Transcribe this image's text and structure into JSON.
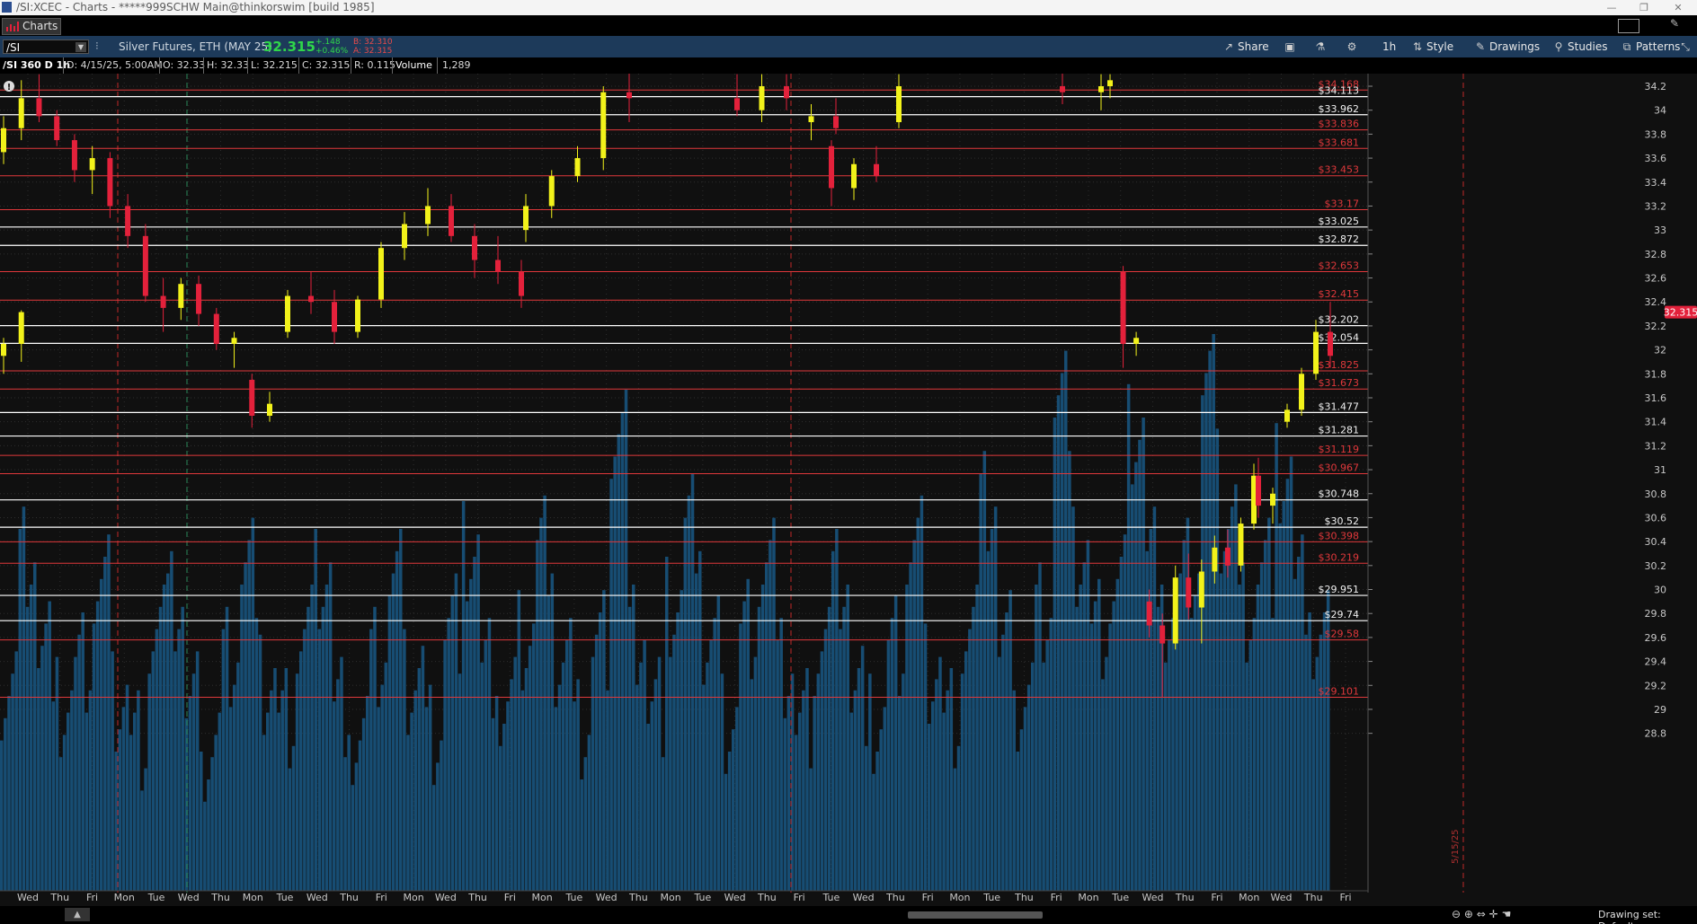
{
  "window": {
    "title": "/SI:XCEC - Charts - *****999SCHW Main@thinkorswim [build 1985]"
  },
  "tabs": {
    "charts_label": "Charts"
  },
  "toolbar": {
    "symbol": "/SI",
    "description": "Silver Futures, ETH (MAY 25)",
    "last": "32.315",
    "change": "+.148",
    "change_pct": "+0.46%",
    "bid": "B: 32.310",
    "ask": "A: 32.315",
    "share_label": "Share",
    "timeframe": "1h",
    "style_label": "Style",
    "drawings_label": "Drawings",
    "studies_label": "Studies",
    "patterns_label": "Patterns"
  },
  "infobar": {
    "chart_id": "/SI 360 D 1h",
    "date": "D: 4/15/25, 5:00AM",
    "open": "O: 32.33",
    "high": "H: 32.33",
    "low": "L: 32.215",
    "close": "C: 32.315",
    "range": "R: 0.115",
    "volume_label": "Volume",
    "volume_value": "1,289"
  },
  "colors": {
    "bg": "#101010",
    "grid": "#2e2e2e",
    "up_candle": "#f2f21a",
    "down_candle": "#e3213b",
    "volume": "#174d73",
    "white_level": "#ffffff",
    "red_level": "#e0383b",
    "price_bubble": "#e3213b"
  },
  "chart_data": {
    "type": "candlestick",
    "current_price": "32.315",
    "ylim": [
      28.7,
      34.35
    ],
    "y_ticks": [
      "34.2",
      "34",
      "33.8",
      "33.6",
      "33.4",
      "33.2",
      "33",
      "32.8",
      "32.6",
      "32.4",
      "32.2",
      "32",
      "31.8",
      "31.6",
      "31.4",
      "31.2",
      "31",
      "30.8",
      "30.6",
      "30.4",
      "30.2",
      "30",
      "29.8",
      "29.6",
      "29.4",
      "29.2",
      "29",
      "28.8"
    ],
    "x_labels": [
      "Wed",
      "Thu",
      "Fri",
      "Mon",
      "Tue",
      "Wed",
      "Thu",
      "Mon",
      "Tue",
      "Wed",
      "Thu",
      "Fri",
      "Mon",
      "Wed",
      "Thu",
      "Fri",
      "Mon",
      "Tue",
      "Wed",
      "Thu",
      "Mon",
      "Tue",
      "Wed",
      "Thu",
      "Fri",
      "Tue",
      "Wed",
      "Thu",
      "Fri",
      "Mon",
      "Tue",
      "Thu",
      "Fri",
      "Mon",
      "Tue",
      "Wed",
      "Thu",
      "Fri",
      "Mon",
      "Wed",
      "Thu",
      "Fri"
    ],
    "vertical_marker_label": "5/15/25",
    "levels": [
      {
        "value": 34.168,
        "label": "$34.168",
        "kind": "red"
      },
      {
        "value": 34.113,
        "label": "$34.113",
        "kind": "white"
      },
      {
        "value": 33.962,
        "label": "$33.962",
        "kind": "white"
      },
      {
        "value": 33.836,
        "label": "$33.836",
        "kind": "red"
      },
      {
        "value": 33.681,
        "label": "$33.681",
        "kind": "red"
      },
      {
        "value": 33.453,
        "label": "$33.453",
        "kind": "red"
      },
      {
        "value": 33.17,
        "label": "$33.17",
        "kind": "red"
      },
      {
        "value": 33.025,
        "label": "$33.025",
        "kind": "white"
      },
      {
        "value": 32.872,
        "label": "$32.872",
        "kind": "white"
      },
      {
        "value": 32.653,
        "label": "$32.653",
        "kind": "red"
      },
      {
        "value": 32.415,
        "label": "$32.415",
        "kind": "red"
      },
      {
        "value": 32.202,
        "label": "$32.202",
        "kind": "white"
      },
      {
        "value": 32.054,
        "label": "$32.054",
        "kind": "white"
      },
      {
        "value": 31.825,
        "label": "$31.825",
        "kind": "red"
      },
      {
        "value": 31.673,
        "label": "$31.673",
        "kind": "red"
      },
      {
        "value": 31.477,
        "label": "$31.477",
        "kind": "white"
      },
      {
        "value": 31.281,
        "label": "$31.281",
        "kind": "white"
      },
      {
        "value": 31.119,
        "label": "$31.119",
        "kind": "red"
      },
      {
        "value": 30.967,
        "label": "$30.967",
        "kind": "red"
      },
      {
        "value": 30.748,
        "label": "$30.748",
        "kind": "white"
      },
      {
        "value": 30.52,
        "label": "$30.52",
        "kind": "white"
      },
      {
        "value": 30.398,
        "label": "$30.398",
        "kind": "red"
      },
      {
        "value": 30.219,
        "label": "$30.219",
        "kind": "red"
      },
      {
        "value": 29.951,
        "label": "$29.951",
        "kind": "white"
      },
      {
        "value": 29.74,
        "label": "$29.74",
        "kind": "white"
      },
      {
        "value": 29.58,
        "label": "$29.58",
        "kind": "red"
      },
      {
        "value": 29.101,
        "label": "$29.101",
        "kind": "red"
      }
    ],
    "candles": [
      [
        33.65,
        33.95,
        33.55,
        33.85
      ],
      [
        33.85,
        34.25,
        33.75,
        34.1
      ],
      [
        34.1,
        34.3,
        33.9,
        33.95
      ],
      [
        33.95,
        34.0,
        33.7,
        33.75
      ],
      [
        33.75,
        33.8,
        33.4,
        33.5
      ],
      [
        33.5,
        33.7,
        33.3,
        33.6
      ],
      [
        33.6,
        33.65,
        33.1,
        33.2
      ],
      [
        33.2,
        33.3,
        32.85,
        32.95
      ],
      [
        32.95,
        33.05,
        32.4,
        32.45
      ],
      [
        32.45,
        32.6,
        32.15,
        32.35
      ],
      [
        32.35,
        32.6,
        32.25,
        32.55
      ],
      [
        32.55,
        32.62,
        32.2,
        32.3
      ],
      [
        32.3,
        32.35,
        32.0,
        32.05
      ],
      [
        32.05,
        32.15,
        31.85,
        32.1
      ],
      [
        31.75,
        31.8,
        31.35,
        31.45
      ],
      [
        31.45,
        31.65,
        31.4,
        31.55
      ],
      [
        32.15,
        32.5,
        32.1,
        32.45
      ],
      [
        32.45,
        32.65,
        32.3,
        32.4
      ],
      [
        32.4,
        32.5,
        32.05,
        32.15
      ],
      [
        32.15,
        32.45,
        32.1,
        32.42
      ],
      [
        32.42,
        32.9,
        32.35,
        32.85
      ],
      [
        32.85,
        33.15,
        32.75,
        33.05
      ],
      [
        33.05,
        33.35,
        32.95,
        33.2
      ],
      [
        33.2,
        33.3,
        32.9,
        32.95
      ],
      [
        32.95,
        33.05,
        32.6,
        32.75
      ],
      [
        32.75,
        32.95,
        32.55,
        32.65
      ],
      [
        32.65,
        32.75,
        32.35,
        32.45
      ],
      [
        33.0,
        33.3,
        32.9,
        33.2
      ],
      [
        33.2,
        33.5,
        33.1,
        33.45
      ],
      [
        33.45,
        33.7,
        33.4,
        33.6
      ],
      [
        33.6,
        34.2,
        33.5,
        34.15
      ],
      [
        34.15,
        34.35,
        33.9,
        34.1
      ],
      [
        34.1,
        34.3,
        33.95,
        34.0
      ],
      [
        34.0,
        34.3,
        33.9,
        34.2
      ],
      [
        34.2,
        34.3,
        34.0,
        34.1
      ],
      [
        33.9,
        34.05,
        33.75,
        33.95
      ],
      [
        33.95,
        34.1,
        33.8,
        33.85
      ],
      [
        33.7,
        33.75,
        33.2,
        33.35
      ],
      [
        33.35,
        33.6,
        33.25,
        33.55
      ],
      [
        33.55,
        33.7,
        33.4,
        33.45
      ],
      [
        33.9,
        34.3,
        33.85,
        34.2
      ],
      [
        34.2,
        34.35,
        34.05,
        34.15
      ],
      [
        34.15,
        34.3,
        34.0,
        34.2
      ],
      [
        34.2,
        34.3,
        34.1,
        34.25
      ],
      [
        32.65,
        32.7,
        31.85,
        32.05
      ],
      [
        32.05,
        32.15,
        31.95,
        32.1
      ],
      [
        29.9,
        30.0,
        29.6,
        29.7
      ],
      [
        29.7,
        29.8,
        29.1,
        29.55
      ],
      [
        29.55,
        30.2,
        29.5,
        30.1
      ],
      [
        30.1,
        30.3,
        29.75,
        29.85
      ],
      [
        29.85,
        30.25,
        29.55,
        30.15
      ],
      [
        30.15,
        30.45,
        30.05,
        30.35
      ],
      [
        30.35,
        30.5,
        30.1,
        30.2
      ],
      [
        30.2,
        30.6,
        30.15,
        30.55
      ],
      [
        30.55,
        31.05,
        30.5,
        30.95
      ],
      [
        30.95,
        31.1,
        30.6,
        30.7
      ],
      [
        30.7,
        30.85,
        30.55,
        30.8
      ],
      [
        31.4,
        31.55,
        31.35,
        31.5
      ],
      [
        31.5,
        31.85,
        31.45,
        31.8
      ],
      [
        31.8,
        32.25,
        31.75,
        32.15
      ],
      [
        32.15,
        32.4,
        31.85,
        31.95
      ],
      [
        31.95,
        32.1,
        31.8,
        32.05
      ],
      [
        32.05,
        32.33,
        31.9,
        32.315
      ]
    ],
    "volume_profile": [
      0.38,
      0.62,
      0.45,
      0.33,
      0.41,
      0.55,
      0.36,
      0.29,
      0.48,
      0.52,
      0.34,
      0.27,
      0.44,
      0.6,
      0.37,
      0.31,
      0.46,
      0.58,
      0.35,
      0.28,
      0.42,
      0.56,
      0.39,
      0.3,
      0.5,
      0.61,
      0.4,
      0.33,
      0.47,
      0.64,
      0.42,
      0.29,
      0.45,
      0.85,
      0.48,
      0.35,
      0.51,
      0.66,
      0.44,
      0.32,
      0.49,
      0.6,
      0.4,
      0.31,
      0.46,
      0.58,
      0.37,
      0.3,
      0.44,
      0.62,
      0.41,
      0.33,
      0.48,
      0.7,
      0.45,
      0.36,
      0.52,
      0.9,
      0.6,
      0.47,
      0.55,
      0.84,
      0.62,
      0.5,
      0.58,
      0.92,
      0.68,
      0.52,
      0.6,
      0.75,
      0.55,
      0.45
    ]
  },
  "bottombar": {
    "collapse_label": "▲",
    "drawing_set": "Drawing set: Default"
  }
}
